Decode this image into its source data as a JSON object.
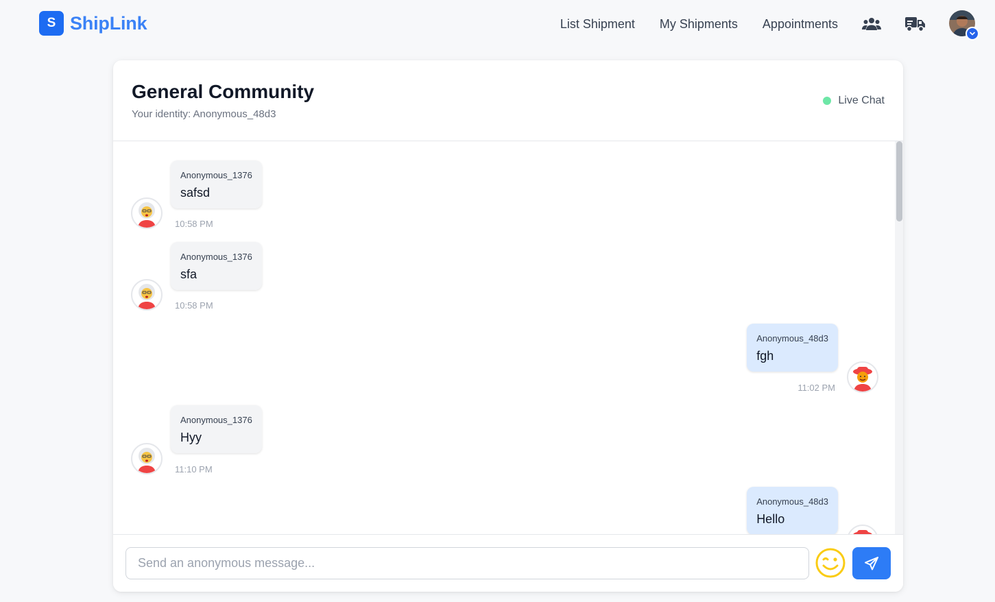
{
  "brand": {
    "logo_letter": "S",
    "name": "ShipLink",
    "color": "#3b82f6"
  },
  "nav": {
    "links": [
      "List Shipment",
      "My Shipments",
      "Appointments"
    ],
    "icons": [
      "users-icon",
      "truck-icon"
    ],
    "avatar": "user-avatar"
  },
  "chat": {
    "title": "General Community",
    "identity": "Your identity: Anonymous_48d3",
    "status": "Live Chat",
    "status_color": "#6ee7a7",
    "messages": [
      {
        "sender": "Anonymous_1376",
        "text": "safsd",
        "time": "10:58 PM",
        "mine": false
      },
      {
        "sender": "Anonymous_1376",
        "text": "sfa",
        "time": "10:58 PM",
        "mine": false
      },
      {
        "sender": "Anonymous_48d3",
        "text": "fgh",
        "time": "11:02 PM",
        "mine": true
      },
      {
        "sender": "Anonymous_1376",
        "text": "Hyy",
        "time": "11:10 PM",
        "mine": false
      },
      {
        "sender": "Anonymous_48d3",
        "text": "Hello",
        "time": "",
        "mine": true
      }
    ],
    "input_placeholder": "Send an anonymous message...",
    "emoji_icon": "wink-emoji-icon",
    "send_icon": "send-icon"
  }
}
